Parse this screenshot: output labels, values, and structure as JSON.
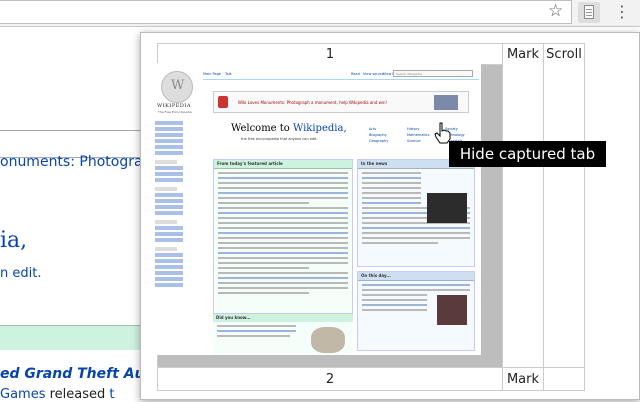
{
  "background_page": {
    "line1": "onuments: Photograp",
    "wiki_word": "ia,",
    "edit_link": "n edit.",
    "gta_text": "ed Grand Theft Auto V",
    "games_link": "Games",
    "games_plain": " released ",
    "games_tail": "t"
  },
  "popup": {
    "table": {
      "row1": {
        "number": "1",
        "mark": "Mark",
        "scroll": "Scroll"
      },
      "row2": {
        "number": "2",
        "mark": "Mark"
      }
    },
    "thumbnail": {
      "wiki_title": "WIKIPEDIA",
      "wiki_subtitle": "The Free Encyclopedia",
      "banner_text": "Wiki Loves Monuments: Photograph a monument, help Wikipedia and win!",
      "welcome_prefix": "Welcome to ",
      "welcome_link": "Wikipedia,",
      "welcome_sub": "the free encyclopedia that anyone can edit.",
      "tfa_heading": "From today's featured article",
      "news_heading": "In the news",
      "otd_heading": "On this day...",
      "dyk_heading": "Did you know...",
      "tab_main": "Main Page",
      "tab_talk": "Talk",
      "tab_read": "Read",
      "tab_view": "View source",
      "tab_history": "View history",
      "search_placeholder": "Search Wikipedia",
      "portals": [
        "Arts",
        "Biography",
        "Geography",
        "History",
        "Mathematics",
        "Science",
        "Society",
        "Technology",
        "All portals"
      ]
    }
  },
  "tooltip": {
    "text": "Hide captured tab"
  },
  "colors": {
    "link_blue": "#0645ad",
    "tooltip_bg": "#000000",
    "tfa_header": "#cef2e0",
    "news_header": "#cedff2"
  },
  "icons": {
    "bookmark": "star-icon",
    "extension": "captured-tabs-icon",
    "menu": "more-vertical-icon"
  }
}
